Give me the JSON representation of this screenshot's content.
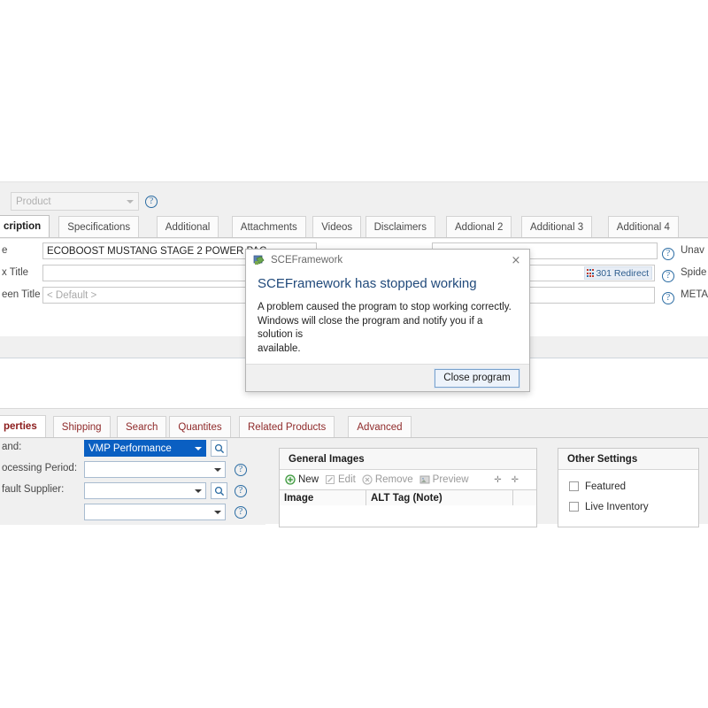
{
  "top_panel": {
    "product_combo": {
      "value": "Product"
    },
    "tabs": [
      {
        "label": "cription",
        "active": true
      },
      {
        "label": "Specifications",
        "active": false
      },
      {
        "label": "Additional",
        "active": false
      },
      {
        "label": "Attachments",
        "active": false
      },
      {
        "label": "Videos",
        "active": false
      },
      {
        "label": "Disclaimers",
        "active": false
      },
      {
        "label": "Addional 2",
        "active": false
      },
      {
        "label": "Additional 3",
        "active": false
      },
      {
        "label": "Additional 4",
        "active": false
      }
    ],
    "fields": [
      {
        "label": "e",
        "value": "ECOBOOST MUSTANG STAGE 2 POWER PAC",
        "right_label": "Unav"
      },
      {
        "label": "x Title",
        "value": "",
        "right_label": "Spide",
        "badge": "301 Redirect"
      },
      {
        "label": "een Title",
        "value": "< Default >",
        "right_label": "META",
        "placeholder": true
      }
    ]
  },
  "bottom_panel": {
    "tabs": [
      {
        "label": "perties",
        "active": true
      },
      {
        "label": "Shipping",
        "active": false
      },
      {
        "label": "Search",
        "active": false
      },
      {
        "label": "Quantites",
        "active": false
      },
      {
        "label": "Related Products",
        "active": false
      },
      {
        "label": "Advanced",
        "active": false
      }
    ],
    "fields": [
      {
        "label": "and:",
        "value": "VMP Performance",
        "selected": true
      },
      {
        "label": "ocessing Period:",
        "value": ""
      },
      {
        "label": "fault Supplier:",
        "value": ""
      },
      {
        "label": "",
        "value": ""
      }
    ],
    "general_images": {
      "title": "General Images",
      "toolbar": [
        {
          "label": "New",
          "icon": "plus-circle-icon",
          "enabled": true
        },
        {
          "label": "Edit",
          "icon": "pencil-icon",
          "enabled": false
        },
        {
          "label": "Remove",
          "icon": "remove-circle-icon",
          "enabled": false
        },
        {
          "label": "Preview",
          "icon": "image-icon",
          "enabled": false
        }
      ],
      "columns": [
        "Image",
        "ALT Tag (Note)"
      ]
    },
    "other_settings": {
      "title": "Other Settings",
      "checkboxes": [
        {
          "label": "Featured",
          "checked": false
        },
        {
          "label": "Live Inventory",
          "checked": false
        }
      ]
    }
  },
  "dialog": {
    "title": "SCEFramework",
    "heading": "SCEFramework has stopped working",
    "body_line1": "A problem caused the program to stop working correctly.",
    "body_line2": "Windows will close the program and notify you if a solution is",
    "body_line3": "available.",
    "close_button": "Close program",
    "close_icon": "×"
  },
  "colors": {
    "accent_blue": "#214a7b",
    "tab_red": "#8b1a1a",
    "select_blue": "#0a5fc2",
    "help_blue": "#2b6ca3"
  }
}
